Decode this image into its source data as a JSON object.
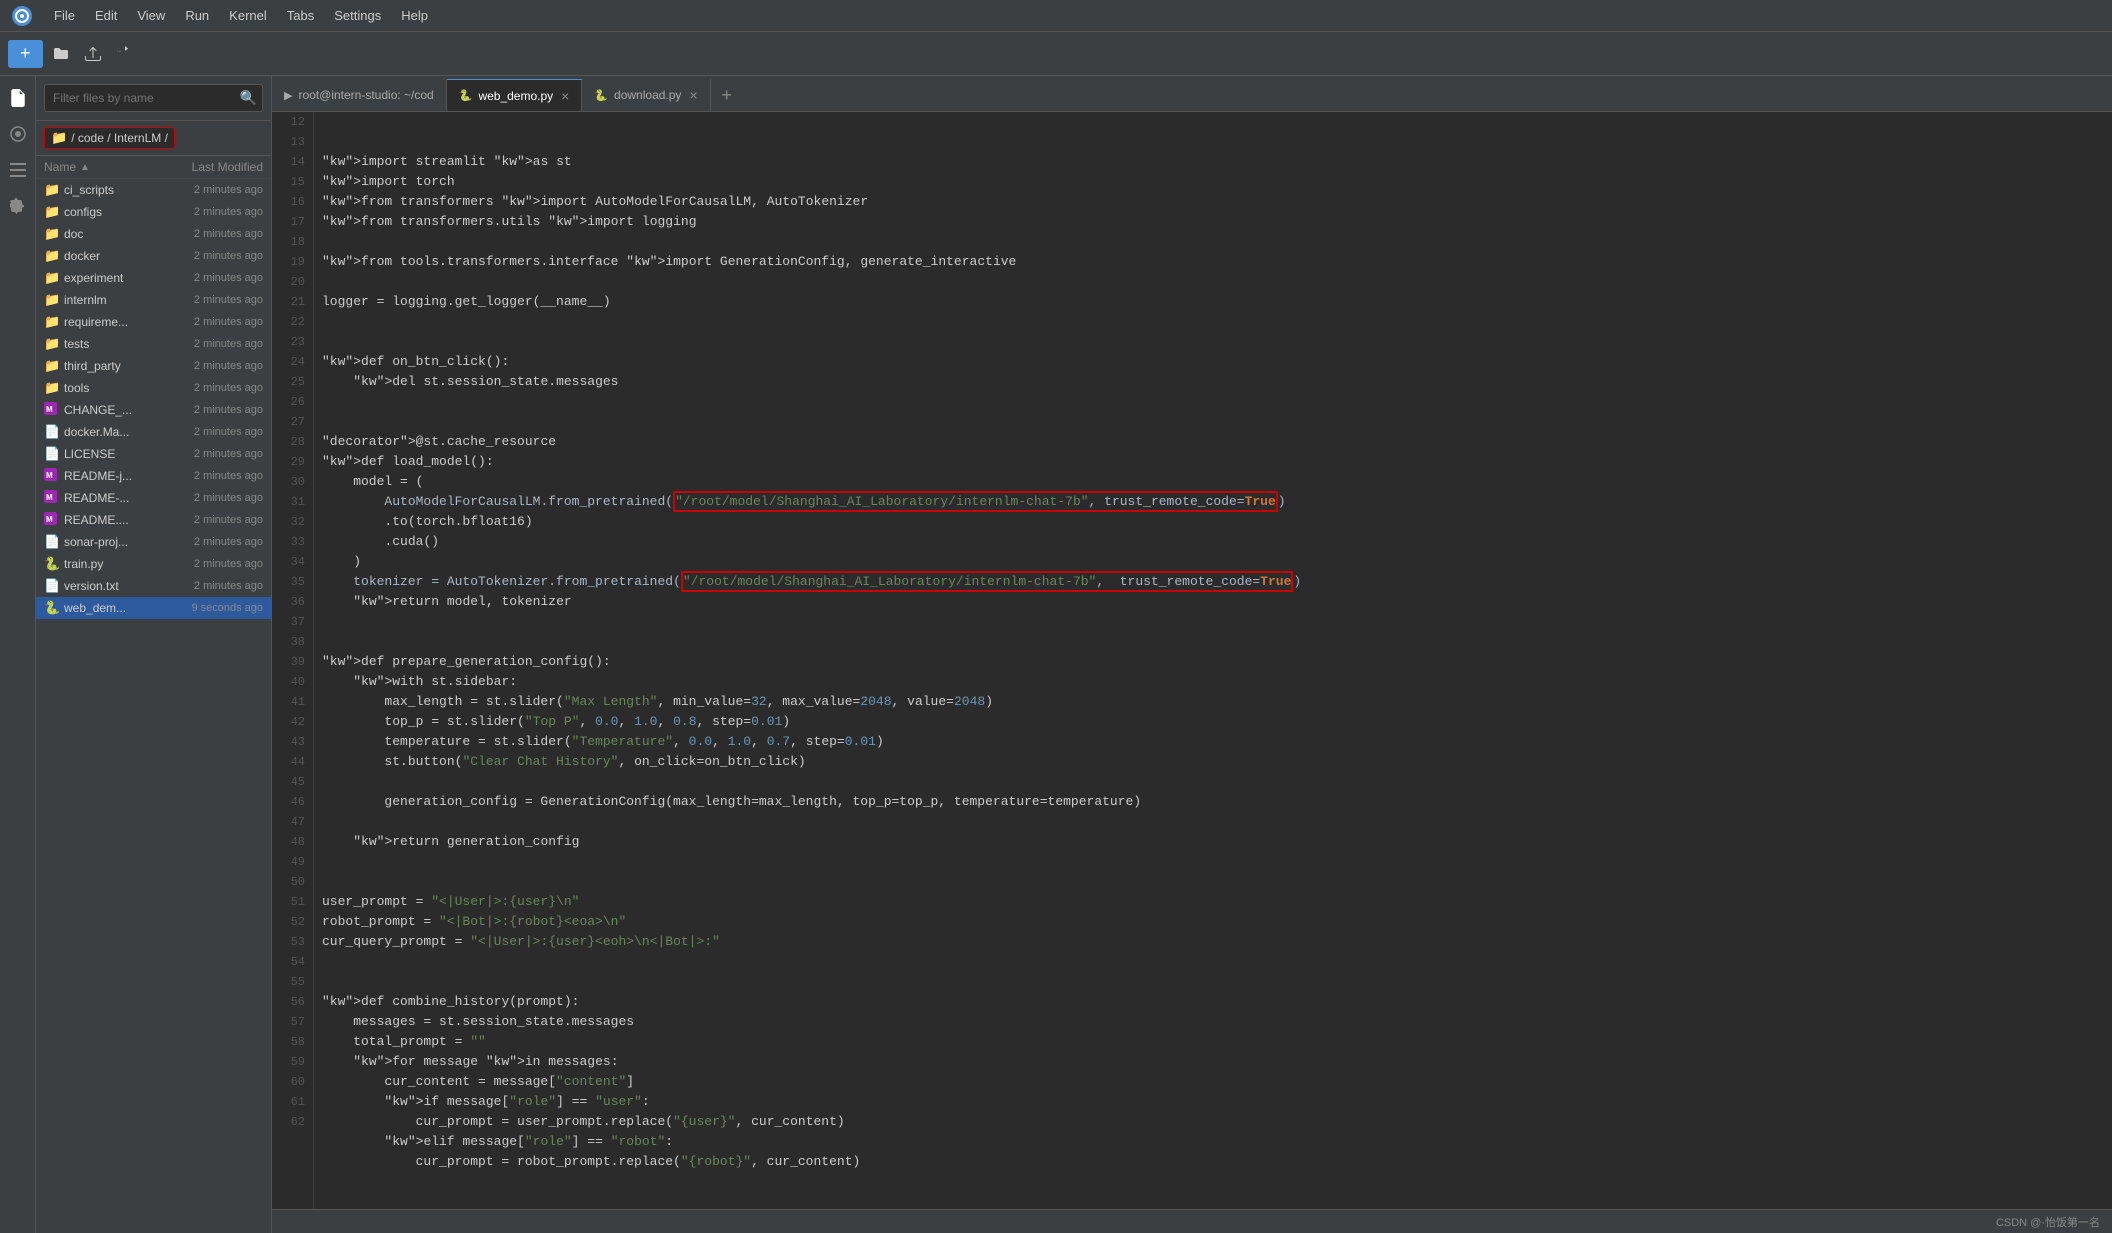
{
  "menubar": {
    "items": [
      "File",
      "Edit",
      "View",
      "Run",
      "Kernel",
      "Tabs",
      "Settings",
      "Help"
    ]
  },
  "toolbar": {
    "new_label": "+",
    "buttons": [
      "folder-open",
      "upload",
      "refresh"
    ]
  },
  "file_panel": {
    "search_placeholder": "Filter files by name",
    "breadcrumb": "/ code / InternLM /",
    "header": {
      "name": "Name",
      "modified": "Last Modified"
    },
    "items": [
      {
        "type": "folder",
        "name": "ci_scripts",
        "modified": "2 minutes ago"
      },
      {
        "type": "folder",
        "name": "configs",
        "modified": "2 minutes ago"
      },
      {
        "type": "folder",
        "name": "doc",
        "modified": "2 minutes ago"
      },
      {
        "type": "folder",
        "name": "docker",
        "modified": "2 minutes ago"
      },
      {
        "type": "folder",
        "name": "experiment",
        "modified": "2 minutes ago"
      },
      {
        "type": "folder",
        "name": "internlm",
        "modified": "2 minutes ago"
      },
      {
        "type": "folder",
        "name": "requireme...",
        "modified": "2 minutes ago"
      },
      {
        "type": "folder",
        "name": "tests",
        "modified": "2 minutes ago"
      },
      {
        "type": "folder",
        "name": "third_party",
        "modified": "2 minutes ago"
      },
      {
        "type": "folder",
        "name": "tools",
        "modified": "2 minutes ago"
      },
      {
        "type": "md",
        "name": "CHANGE_...",
        "modified": "2 minutes ago"
      },
      {
        "type": "file",
        "name": "docker.Ma...",
        "modified": "2 minutes ago"
      },
      {
        "type": "file",
        "name": "LICENSE",
        "modified": "2 minutes ago"
      },
      {
        "type": "md",
        "name": "README-j...",
        "modified": "2 minutes ago"
      },
      {
        "type": "md",
        "name": "README-...",
        "modified": "2 minutes ago"
      },
      {
        "type": "md",
        "name": "README....",
        "modified": "2 minutes ago"
      },
      {
        "type": "file",
        "name": "sonar-proj...",
        "modified": "2 minutes ago"
      },
      {
        "type": "py",
        "name": "train.py",
        "modified": "2 minutes ago"
      },
      {
        "type": "txt",
        "name": "version.txt",
        "modified": "2 minutes ago"
      },
      {
        "type": "py",
        "name": "web_dem...",
        "modified": "9 seconds ago",
        "selected": true
      }
    ]
  },
  "tabs": [
    {
      "label": "root@intern-studio: ~/cod",
      "closeable": false,
      "active": false,
      "icon": "terminal"
    },
    {
      "label": "web_demo.py",
      "closeable": true,
      "active": true,
      "icon": "py"
    },
    {
      "label": "download.py",
      "closeable": true,
      "active": false,
      "icon": "py"
    }
  ],
  "code": {
    "lines": [
      {
        "n": 12,
        "text": "import streamlit as st"
      },
      {
        "n": 13,
        "text": "import torch"
      },
      {
        "n": 14,
        "text": "from transformers import AutoModelForCausalLM, AutoTokenizer"
      },
      {
        "n": 15,
        "text": "from transformers.utils import logging"
      },
      {
        "n": 16,
        "text": ""
      },
      {
        "n": 17,
        "text": "from tools.transformers.interface import GenerationConfig, generate_interactive"
      },
      {
        "n": 18,
        "text": ""
      },
      {
        "n": 19,
        "text": "logger = logging.get_logger(__name__)"
      },
      {
        "n": 20,
        "text": ""
      },
      {
        "n": 21,
        "text": ""
      },
      {
        "n": 22,
        "text": "def on_btn_click():"
      },
      {
        "n": 23,
        "text": "    del st.session_state.messages"
      },
      {
        "n": 24,
        "text": ""
      },
      {
        "n": 25,
        "text": ""
      },
      {
        "n": 26,
        "text": "@st.cache_resource"
      },
      {
        "n": 27,
        "text": "def load_model():"
      },
      {
        "n": 28,
        "text": "    model = ("
      },
      {
        "n": 29,
        "text": "        AutoModelForCausalLM.from_pretrained(\"/root/model/Shanghai_AI_Laboratory/internlm-chat-7b\", trust_remote_code=True)"
      },
      {
        "n": 30,
        "text": "        .to(torch.bfloat16)"
      },
      {
        "n": 31,
        "text": "        .cuda()"
      },
      {
        "n": 32,
        "text": "    )"
      },
      {
        "n": 33,
        "text": "    tokenizer = AutoTokenizer.from_pretrained(\"/root/model/Shanghai_AI_Laboratory/internlm-chat-7b\",  trust_remote_code=True)"
      },
      {
        "n": 34,
        "text": "    return model, tokenizer"
      },
      {
        "n": 35,
        "text": ""
      },
      {
        "n": 36,
        "text": ""
      },
      {
        "n": 37,
        "text": "def prepare_generation_config():"
      },
      {
        "n": 38,
        "text": "    with st.sidebar:"
      },
      {
        "n": 39,
        "text": "        max_length = st.slider(\"Max Length\", min_value=32, max_value=2048, value=2048)"
      },
      {
        "n": 40,
        "text": "        top_p = st.slider(\"Top P\", 0.0, 1.0, 0.8, step=0.01)"
      },
      {
        "n": 41,
        "text": "        temperature = st.slider(\"Temperature\", 0.0, 1.0, 0.7, step=0.01)"
      },
      {
        "n": 42,
        "text": "        st.button(\"Clear Chat History\", on_click=on_btn_click)"
      },
      {
        "n": 43,
        "text": ""
      },
      {
        "n": 44,
        "text": "        generation_config = GenerationConfig(max_length=max_length, top_p=top_p, temperature=temperature)"
      },
      {
        "n": 45,
        "text": ""
      },
      {
        "n": 46,
        "text": "    return generation_config"
      },
      {
        "n": 47,
        "text": ""
      },
      {
        "n": 48,
        "text": ""
      },
      {
        "n": 49,
        "text": "user_prompt = \"<|User|>:{user}\\n\""
      },
      {
        "n": 50,
        "text": "robot_prompt = \"<|Bot|>:{robot}<eoa>\\n\""
      },
      {
        "n": 51,
        "text": "cur_query_prompt = \"<|User|>:{user}<eoh>\\n<|Bot|>:\""
      },
      {
        "n": 52,
        "text": ""
      },
      {
        "n": 53,
        "text": ""
      },
      {
        "n": 54,
        "text": "def combine_history(prompt):"
      },
      {
        "n": 55,
        "text": "    messages = st.session_state.messages"
      },
      {
        "n": 56,
        "text": "    total_prompt = \"\""
      },
      {
        "n": 57,
        "text": "    for message in messages:"
      },
      {
        "n": 58,
        "text": "        cur_content = message[\"content\"]"
      },
      {
        "n": 59,
        "text": "        if message[\"role\"] == \"user\":"
      },
      {
        "n": 60,
        "text": "            cur_prompt = user_prompt.replace(\"{user}\", cur_content)"
      },
      {
        "n": 61,
        "text": "        elif message[\"role\"] == \"robot\":"
      },
      {
        "n": 62,
        "text": "            cur_prompt = robot_prompt.replace(\"{robot}\", cur_content)"
      }
    ]
  },
  "status_bar": {
    "watermark": "CSDN @·怡饭第一名"
  }
}
